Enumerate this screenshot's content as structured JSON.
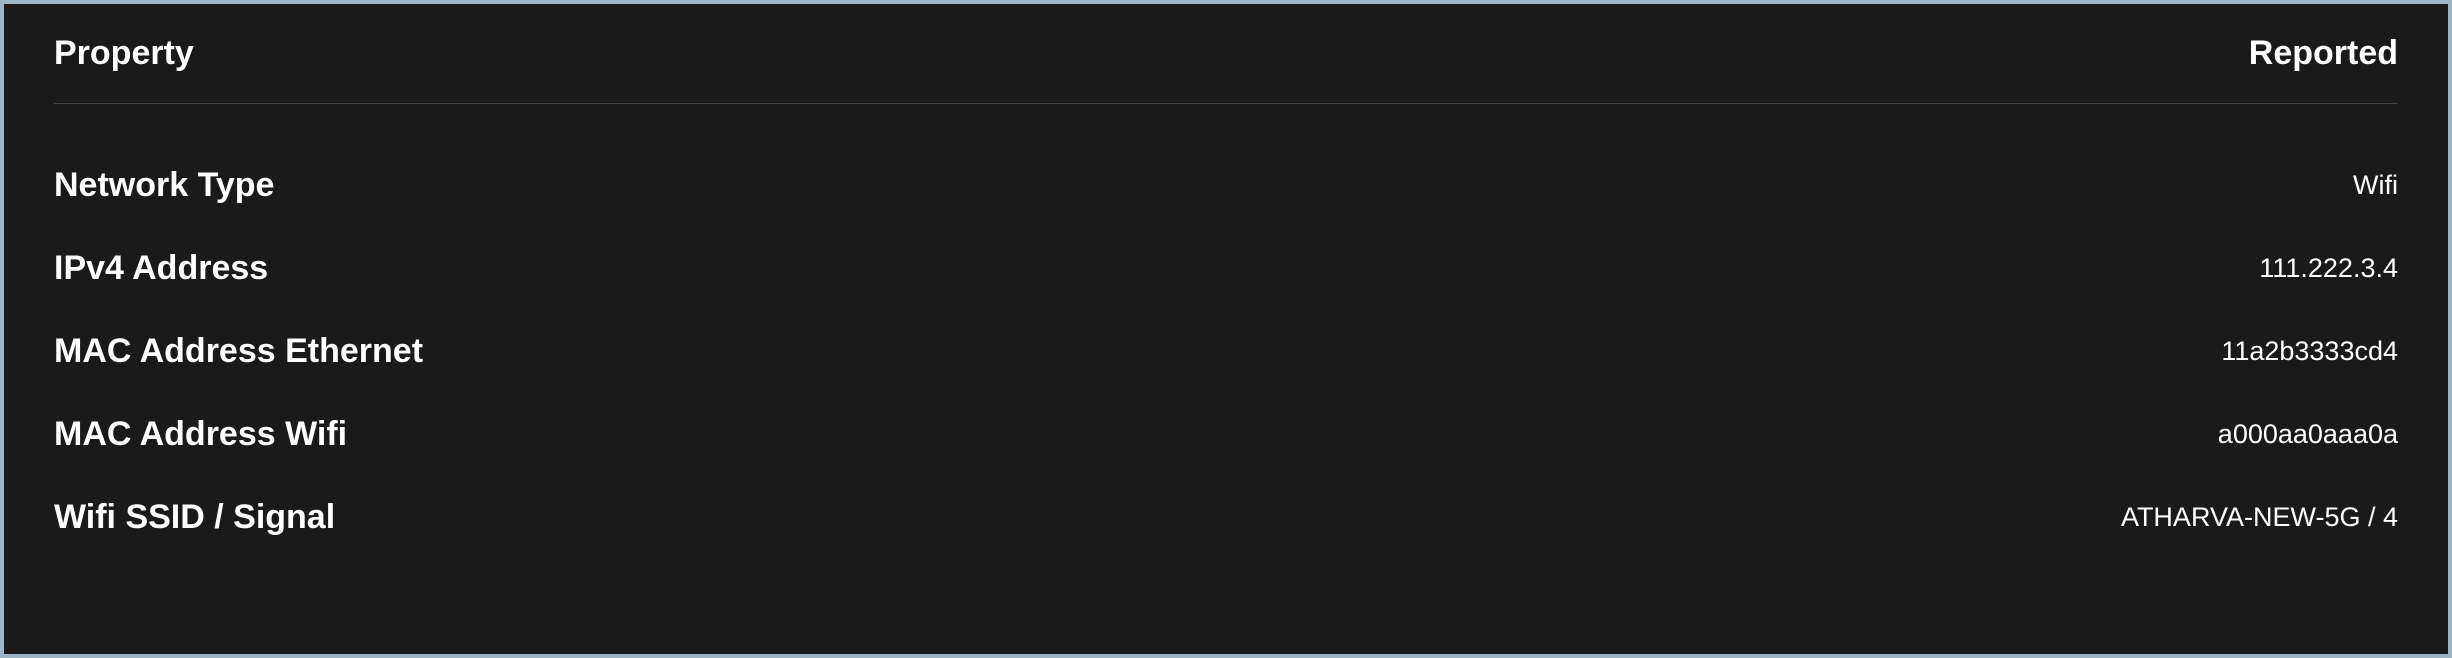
{
  "header": {
    "property": "Property",
    "reported": "Reported"
  },
  "rows": [
    {
      "label": "Network Type",
      "value": "Wifi"
    },
    {
      "label": "IPv4 Address",
      "value": "111.222.3.4"
    },
    {
      "label": "MAC Address Ethernet",
      "value": "11a2b3333cd4"
    },
    {
      "label": "MAC Address Wifi",
      "value": "a000aa0aaa0a"
    },
    {
      "label": "Wifi SSID / Signal",
      "value": "ATHARVA-NEW-5G / 4"
    }
  ]
}
